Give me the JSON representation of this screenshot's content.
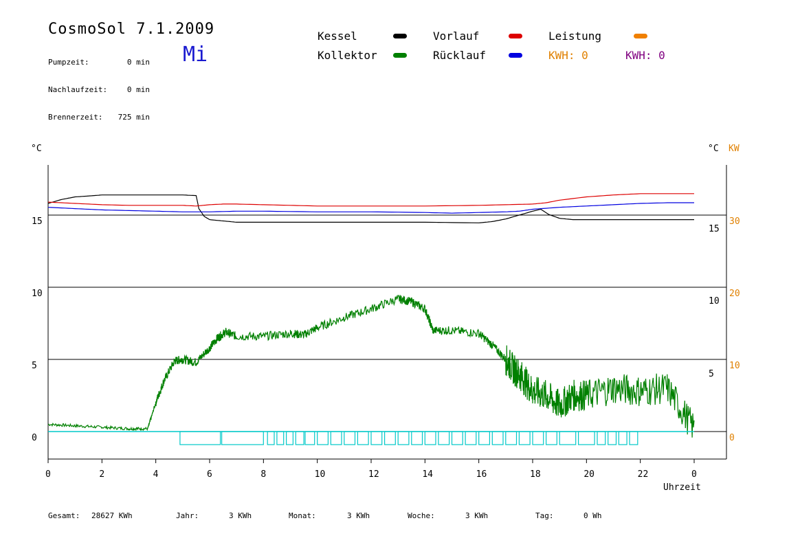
{
  "header": {
    "title": "CosmoSol 7.1.2009",
    "day": "Mi",
    "stats": [
      {
        "label": "Pumpzeit:",
        "value": "0 min"
      },
      {
        "label": "Nachlaufzeit:",
        "value": "0 min"
      },
      {
        "label": "Brennerzeit:",
        "value": "725 min"
      }
    ]
  },
  "legend": {
    "items": [
      {
        "label": "Kessel",
        "color": "#000000"
      },
      {
        "label": "Vorlauf",
        "color": "#dd0000"
      },
      {
        "label": "Leistung",
        "color": "#f08000"
      },
      {
        "label": "Kollektor",
        "color": "#008000"
      },
      {
        "label": "Rücklauf",
        "color": "#0000e0"
      }
    ],
    "kwh_orange": "KWH: 0",
    "kwh_purple": "KWH: 0",
    "kwh_orange_color": "#e08000",
    "kwh_purple_color": "#800080"
  },
  "axes": {
    "left_unit": "°C",
    "right_unit": "°C",
    "right_unit2": "KW",
    "x_title": "Uhrzeit"
  },
  "footer": {
    "gesamt_label": "Gesamt:",
    "gesamt_value": "28627 KWh",
    "jahr_label": "Jahr:",
    "jahr_value": "3 KWh",
    "monat_label": "Monat:",
    "monat_value": "3 KWh",
    "woche_label": "Woche:",
    "woche_value": "3 KWh",
    "tag_label": "Tag:",
    "tag_value": "0 Wh"
  },
  "chart_data": {
    "type": "line",
    "title": "CosmoSol 7.1.2009",
    "xlabel": "Uhrzeit",
    "x_ticks": [
      "0",
      "2",
      "4",
      "6",
      "8",
      "10",
      "12",
      "14",
      "16",
      "18",
      "20",
      "22",
      "0"
    ],
    "xlim": [
      0,
      24
    ],
    "panels": [
      {
        "name": "upper",
        "left_ticks": [
          "15"
        ],
        "right_ticks": [
          "15"
        ],
        "right2_ticks": [
          "30"
        ],
        "series": [
          {
            "name": "Kessel",
            "color": "#000000",
            "x": [
              0,
              0.5,
              1,
              1.7,
              2,
              3,
              4,
              5,
              5.5,
              5.6,
              5.8,
              6,
              6.5,
              7,
              8,
              10,
              12,
              14,
              16,
              16.5,
              17,
              17.5,
              18,
              18.3,
              18.6,
              19,
              19.5,
              20,
              22,
              24
            ],
            "y": [
              16.8,
              17.4,
              17.8,
              18.0,
              18.1,
              18.1,
              18.1,
              18.1,
              18.0,
              16.0,
              14.8,
              14.3,
              14.1,
              13.9,
              13.9,
              13.9,
              13.9,
              13.9,
              13.8,
              14.0,
              14.4,
              15.0,
              15.6,
              15.9,
              15.1,
              14.5,
              14.3,
              14.3,
              14.3,
              14.3
            ]
          },
          {
            "name": "Vorlauf",
            "color": "#dd0000",
            "x": [
              0,
              1,
              2,
              3,
              4,
              5,
              5.5,
              6,
              6.5,
              7,
              8,
              9,
              10,
              12,
              14,
              16,
              17,
              18,
              18.5,
              19,
              20,
              21,
              22,
              23,
              24
            ],
            "y": [
              17.0,
              16.8,
              16.6,
              16.5,
              16.5,
              16.5,
              16.4,
              16.6,
              16.7,
              16.7,
              16.6,
              16.5,
              16.4,
              16.4,
              16.4,
              16.5,
              16.6,
              16.7,
              16.9,
              17.3,
              17.8,
              18.1,
              18.3,
              18.3,
              18.3
            ]
          },
          {
            "name": "Rücklauf",
            "color": "#0000e0",
            "x": [
              0,
              1,
              2,
              3,
              4,
              5,
              6,
              7,
              8,
              10,
              12,
              14,
              15,
              16,
              17,
              17.5,
              18,
              19,
              20,
              21,
              22,
              23,
              24
            ],
            "y": [
              16.2,
              16.0,
              15.8,
              15.7,
              15.6,
              15.5,
              15.5,
              15.6,
              15.6,
              15.5,
              15.5,
              15.4,
              15.3,
              15.4,
              15.5,
              15.6,
              15.9,
              16.2,
              16.4,
              16.6,
              16.8,
              16.9,
              16.9
            ]
          }
        ]
      },
      {
        "name": "lower",
        "left_ticks": [
          "10",
          "5",
          "0"
        ],
        "right_ticks": [
          "10",
          "5"
        ],
        "right2_ticks": [
          "20",
          "10",
          "0"
        ],
        "series": [
          {
            "name": "Kollektor",
            "color": "#008000",
            "x": [
              0,
              1,
              2,
              3,
              3.7,
              4,
              4.3,
              4.7,
              5,
              5.5,
              6,
              6.3,
              6.6,
              7,
              8,
              9,
              9.5,
              10,
              11,
              12,
              13,
              13.5,
              14,
              14.3,
              15,
              16,
              16.5,
              17,
              17.3,
              17.6,
              18,
              18.5,
              19,
              19.5,
              20,
              21,
              22,
              23,
              24
            ],
            "y": [
              0.5,
              0.4,
              0.3,
              0.2,
              0.2,
              2.0,
              3.5,
              4.9,
              5.0,
              4.8,
              5.8,
              6.5,
              6.9,
              6.6,
              6.6,
              6.8,
              6.7,
              7.2,
              7.9,
              8.5,
              9.2,
              9.0,
              8.5,
              7.0,
              7.0,
              6.8,
              6.0,
              5.0,
              4.3,
              3.8,
              2.8,
              2.5,
              1.8,
              2.5,
              2.5,
              3.0,
              2.8,
              3.0,
              0.2
            ]
          }
        ]
      }
    ],
    "bars": {
      "name": "Leistung",
      "color": "#00c8c8",
      "note": "cyan pump activity rectangles"
    }
  }
}
